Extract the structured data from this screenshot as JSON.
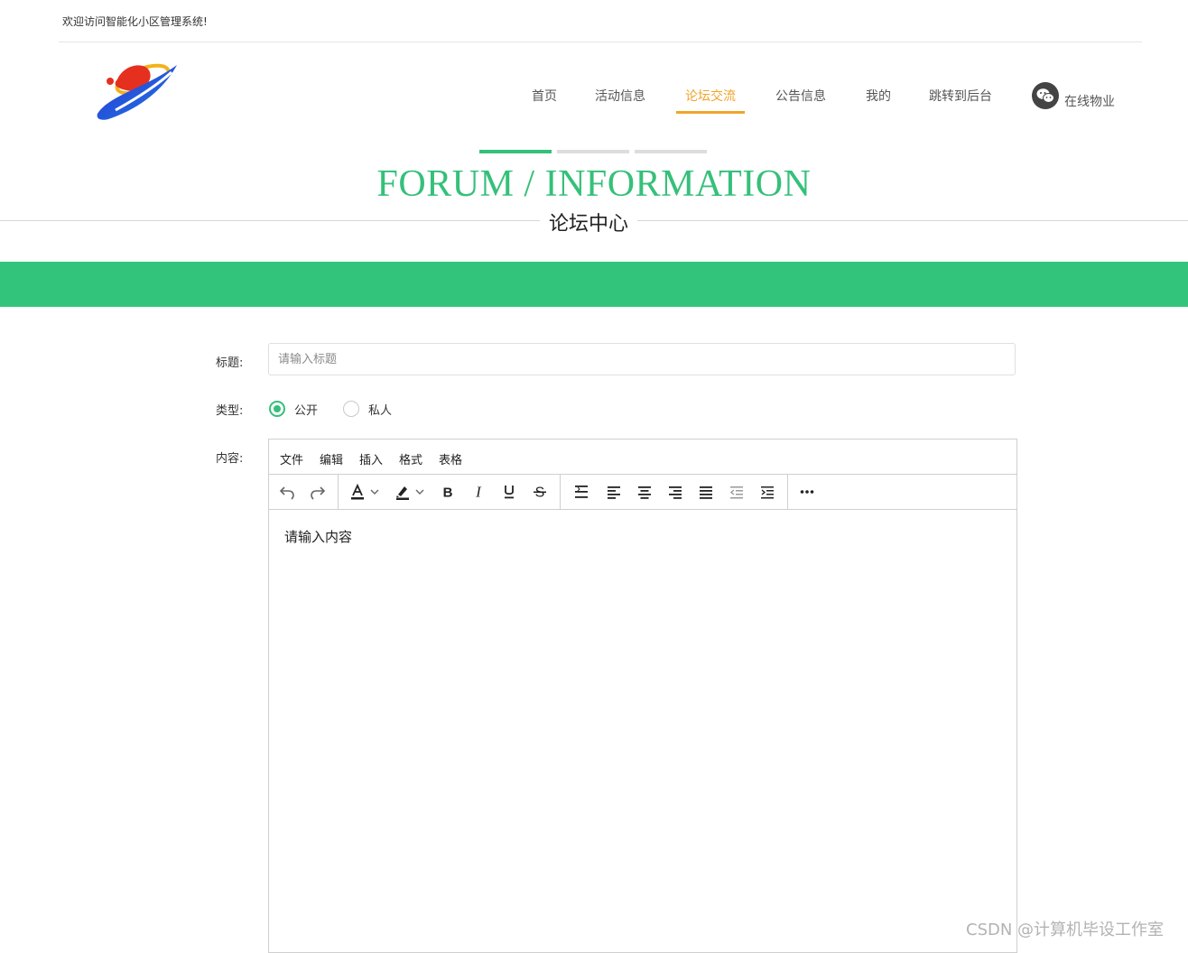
{
  "header": {
    "welcome_text": "欢迎访问智能化小区管理系统!",
    "nav": [
      {
        "label": "首页",
        "active": false
      },
      {
        "label": "活动信息",
        "active": false
      },
      {
        "label": "论坛交流",
        "active": true
      },
      {
        "label": "公告信息",
        "active": false
      },
      {
        "label": "我的",
        "active": false
      },
      {
        "label": "跳转到后台",
        "active": false
      }
    ],
    "online_service_label": "在线物业",
    "accent_color": "#f0a52a"
  },
  "section": {
    "title_en": "FORUM / INFORMATION",
    "title_cn": "论坛中心",
    "accent_color": "#35c07a",
    "band_color": "#33c47c"
  },
  "form": {
    "title_label": "标题:",
    "title_placeholder": "请输入标题",
    "title_value": "",
    "type_label": "类型:",
    "type_options": [
      {
        "label": "公开",
        "checked": true
      },
      {
        "label": "私人",
        "checked": false
      }
    ],
    "content_label": "内容:"
  },
  "editor": {
    "menus": [
      "文件",
      "编辑",
      "插入",
      "格式",
      "表格"
    ],
    "toolbar_icons": [
      "undo-icon",
      "redo-icon",
      "text-color-icon",
      "highlight-color-icon",
      "bold-icon",
      "italic-icon",
      "underline-icon",
      "strikethrough-icon",
      "line-height-icon",
      "align-left-icon",
      "align-center-icon",
      "align-right-icon",
      "align-justify-icon",
      "outdent-icon",
      "indent-icon",
      "more-icon"
    ],
    "content_placeholder": "请输入内容"
  },
  "watermark": "CSDN @计算机毕设工作室"
}
